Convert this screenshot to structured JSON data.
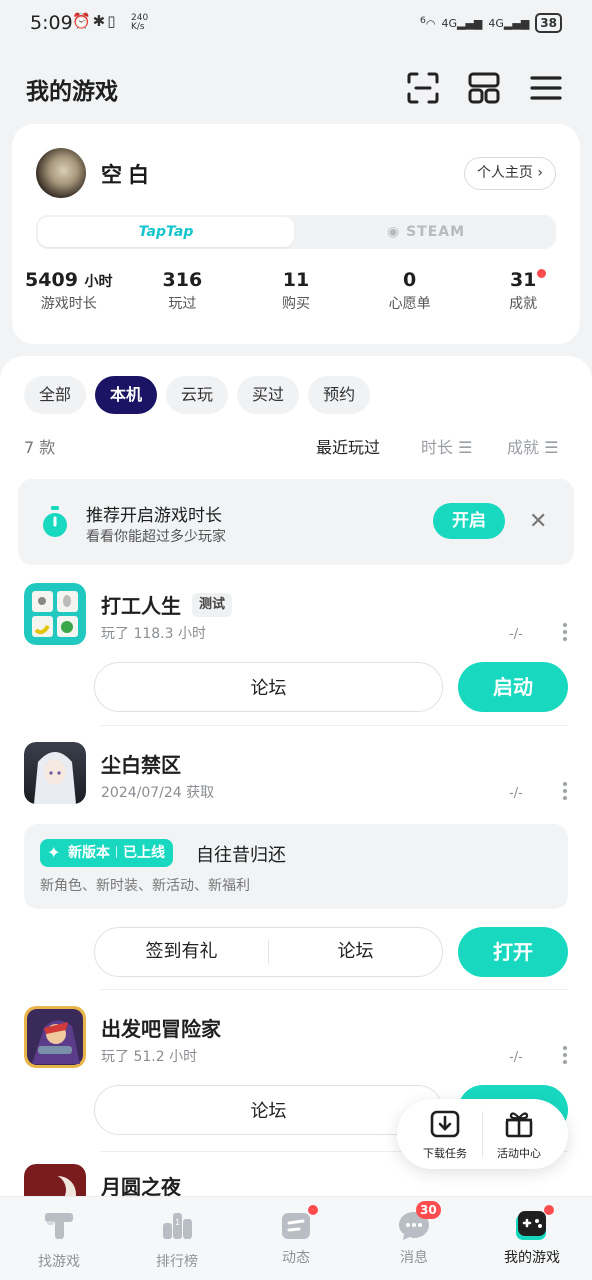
{
  "status_bar": {
    "time": "5:09",
    "net_speed_top": "240",
    "net_speed_unit": "K/s",
    "signal_1": "4G",
    "signal_2": "4G",
    "wifi_label": "6",
    "battery": "38"
  },
  "header": {
    "title": "我的游戏",
    "icons": [
      "scan-icon",
      "grid-icon",
      "menu-icon"
    ]
  },
  "profile": {
    "username": "空白",
    "profile_button": "个人主页",
    "platforms": {
      "taptap": "TapTap",
      "steam": "STEAM"
    },
    "stats": [
      {
        "value": "5409",
        "unit": "小时",
        "label": "游戏时长"
      },
      {
        "value": "316",
        "unit": "",
        "label": "玩过"
      },
      {
        "value": "11",
        "unit": "",
        "label": "购买"
      },
      {
        "value": "0",
        "unit": "",
        "label": "心愿单"
      },
      {
        "value": "31",
        "unit": "",
        "label": "成就"
      }
    ]
  },
  "filters": {
    "chips": [
      "全部",
      "本机",
      "云玩",
      "买过",
      "预约"
    ],
    "active": "本机",
    "count": "7 款",
    "sorts": [
      "最近玩过",
      "时长",
      "成就"
    ]
  },
  "tip": {
    "title": "推荐开启游戏时长",
    "subtitle": "看看你能超过多少玩家",
    "button": "开启"
  },
  "games": [
    {
      "name": "打工人生",
      "badge": "测试",
      "sub": "玩了 118.3 小时",
      "size": "-/-",
      "forum": "论坛",
      "action": "启动"
    },
    {
      "name": "尘白禁区",
      "sub": "2024/07/24 获取",
      "size": "-/-",
      "update_badge_a": "新版本",
      "update_badge_b": "已上线",
      "update_title": "自往昔归还",
      "update_sub": "新角色、新时装、新活动、新福利",
      "checkin": "签到有礼",
      "forum": "论坛",
      "action": "打开"
    },
    {
      "name": "出发吧冒险家",
      "sub": "玩了 51.2 小时",
      "size": "-/-",
      "forum": "论坛"
    },
    {
      "name": "月圆之夜"
    }
  ],
  "floating": {
    "download": "下载任务",
    "activity": "活动中心"
  },
  "tabbar": {
    "items": [
      "找游戏",
      "排行榜",
      "动态",
      "消息",
      "我的游戏"
    ],
    "messages_badge": "30",
    "active": "我的游戏"
  },
  "colors": {
    "accent": "#18d9c0",
    "active_chip": "#1b1464",
    "badge_red": "#ff4d4f",
    "background": "#f1f3f5"
  }
}
